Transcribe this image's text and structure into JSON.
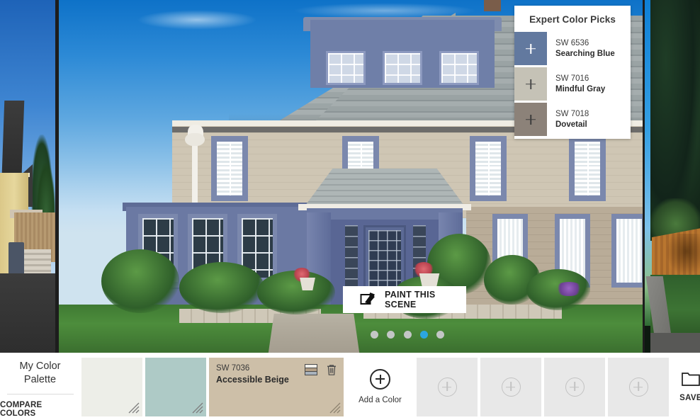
{
  "scene": {
    "paint_button": {
      "label": "PAINT THIS SCENE",
      "icon": "paint-roller-icon"
    },
    "carousel": {
      "total_dots": 5,
      "active_index": 3
    }
  },
  "expert_panel": {
    "title": "Expert Color Picks",
    "picks": [
      {
        "code": "SW 6536",
        "name": "Searching Blue",
        "hex": "#62799f",
        "plus_color": "#ffffff"
      },
      {
        "code": "SW 7016",
        "name": "Mindful Gray",
        "hex": "#c5c2b6",
        "plus_color": "#4a4a4a"
      },
      {
        "code": "SW 7018",
        "name": "Dovetail",
        "hex": "#8c8279",
        "plus_color": "#3c3c3c"
      }
    ]
  },
  "palette_bar": {
    "title_line1": "My Color",
    "title_line2": "Palette",
    "compare_label": "COMPARE COLORS",
    "add_color_label": "Add a Color",
    "save_label": "SAVE",
    "swatches": [
      {
        "hex": "#edeee8",
        "code": "",
        "name": "",
        "has_labels": false
      },
      {
        "hex": "#aecac6",
        "code": "",
        "name": "",
        "has_labels": false
      },
      {
        "hex": "#cdbfa8",
        "code": "SW 7036",
        "name": "Accessible Beige",
        "has_labels": true
      }
    ],
    "swatch_icons": {
      "stripes_icon": "color-strip-icon",
      "stripes_colors": [
        "#f2efe9",
        "#b39f86",
        "#a9b3bd"
      ],
      "trash_icon": "trash-icon"
    },
    "empty_slots": 4
  },
  "colors": {
    "accent_blue": "#2ba6e0",
    "bar_background": "#ffffff",
    "empty_slot": "#e8e8e8"
  }
}
